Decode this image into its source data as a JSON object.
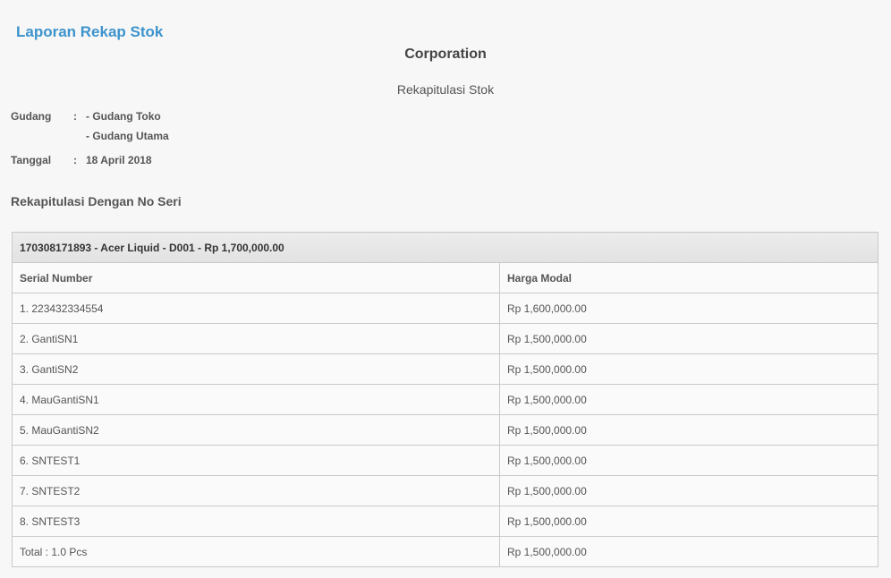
{
  "header": {
    "app_title": "Laporan Rekap Stok",
    "company": "Corporation",
    "report_name": "Rekapitulasi Stok"
  },
  "meta": {
    "gudang_label": "Gudang",
    "gudang_values": [
      "- Gudang Toko",
      "- Gudang Utama"
    ],
    "tanggal_label": "Tanggal",
    "tanggal_value": "18 April 2018",
    "colon": ":"
  },
  "section": {
    "title": "Rekapitulasi Dengan No Seri"
  },
  "table": {
    "group_header": "170308171893 - Acer Liquid - D001 - Rp 1,700,000.00",
    "columns": [
      "Serial Number",
      "Harga Modal"
    ],
    "rows": [
      {
        "serial": "1. 223432334554",
        "harga": "Rp 1,600,000.00"
      },
      {
        "serial": "2. GantiSN1",
        "harga": "Rp 1,500,000.00"
      },
      {
        "serial": "3. GantiSN2",
        "harga": "Rp 1,500,000.00"
      },
      {
        "serial": "4. MauGantiSN1",
        "harga": "Rp 1,500,000.00"
      },
      {
        "serial": "5. MauGantiSN2",
        "harga": "Rp 1,500,000.00"
      },
      {
        "serial": "6. SNTEST1",
        "harga": "Rp 1,500,000.00"
      },
      {
        "serial": "7. SNTEST2",
        "harga": "Rp 1,500,000.00"
      },
      {
        "serial": "8. SNTEST3",
        "harga": "Rp 1,500,000.00"
      }
    ],
    "total": {
      "label": "Total : 1.0 Pcs",
      "harga": "Rp 1,500,000.00"
    }
  }
}
